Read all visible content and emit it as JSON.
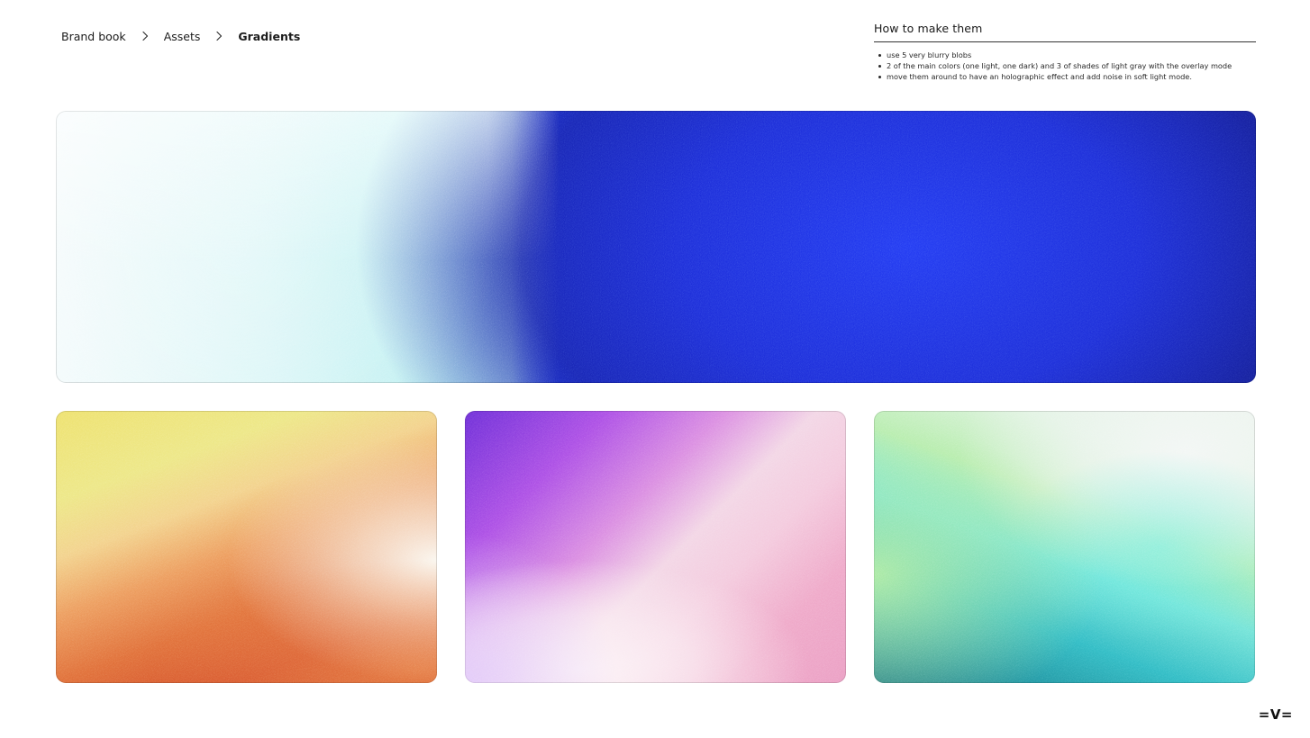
{
  "breadcrumb": {
    "items": [
      "Brand book",
      "Assets"
    ],
    "current": "Gradients"
  },
  "howto": {
    "title": "How to make them",
    "steps": [
      "use 5 very blurry blobs",
      "2  of the main colors (one light, one dark) and 3 of shades of light gray with the overlay mode",
      "move them around to have an holographic effect and add noise in soft light mode."
    ]
  },
  "gradients": {
    "hero": {
      "colors": [
        "#f4fbfc",
        "#b7eff0",
        "#1f3bf0",
        "#15209e",
        "#0f1563"
      ]
    },
    "orange": {
      "colors": [
        "#ede06a",
        "#faf6ee",
        "#ec9a5a",
        "#d34b25"
      ]
    },
    "pink": {
      "colors": [
        "#6a2ad6",
        "#a94ae4",
        "#f2d4e4",
        "#ea9bc1"
      ]
    },
    "green": {
      "colors": [
        "#eef3ef",
        "#b5ecac",
        "#6fe2d6",
        "#116f7f"
      ]
    }
  },
  "logo": {
    "text": "=V="
  },
  "icons": {
    "breadcrumb_separator": "chevron-right-icon"
  }
}
